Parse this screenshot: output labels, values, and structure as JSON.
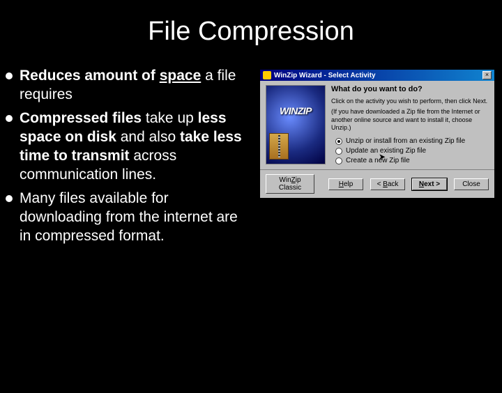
{
  "title": "File Compression",
  "bullets": [
    {
      "prefix_b": "Reduces amount of ",
      "u_b": "space",
      "tail": " a file requires"
    },
    {
      "prefix_b": "Compressed files",
      "mid1": " take up ",
      "b2": "less space on disk",
      "mid2": " and also ",
      "b3": "take less time to transmit",
      "tail": " across communication lines."
    },
    {
      "plain": "Many files available for downloading from the internet are in compressed format."
    }
  ],
  "dialog": {
    "titlebar": "WinZip Wizard - Select Activity",
    "close_x": "×",
    "logo_text": "WINZIP",
    "prompt": "What do you want to do?",
    "instruction": "Click on the activity you wish to perform, then click Next.",
    "hint": "(If you have downloaded a Zip file from the Internet or another online source and want to install it, choose Unzip.)",
    "options": [
      {
        "label": "Unzip or install from an existing Zip file",
        "checked": true
      },
      {
        "label": "Update an existing Zip file",
        "checked": false
      },
      {
        "label": "Create a new Zip file",
        "checked": false
      }
    ],
    "buttons": {
      "classic_pre": "Win",
      "classic_u": "Z",
      "classic_post": "ip Classic",
      "help_u": "H",
      "help_post": "elp",
      "back_pre": "< ",
      "back_u": "B",
      "back_post": "ack",
      "next_u": "N",
      "next_post": "ext >",
      "close": "Close"
    }
  }
}
